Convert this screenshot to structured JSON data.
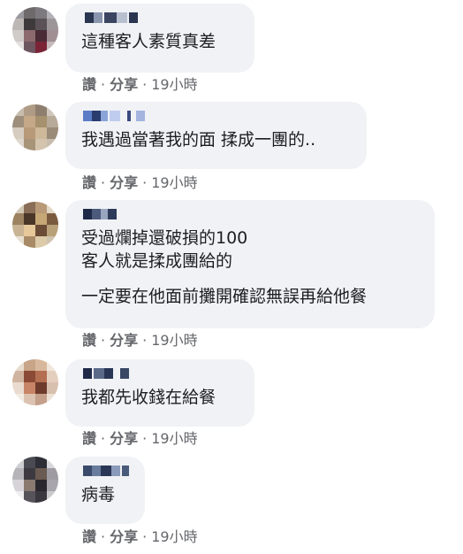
{
  "comments": [
    {
      "lines": [
        "這種客人素質真差"
      ],
      "actions": {
        "like": "讚",
        "share": "分享",
        "separator": "·",
        "time": "19小時"
      }
    },
    {
      "lines": [
        "我遇過當著我的面 揉成一團的.."
      ],
      "actions": {
        "like": "讚",
        "share": "分享",
        "separator": "·",
        "time": "19小時"
      }
    },
    {
      "lines": [
        "受過爛掉還破損的100",
        "客人就是揉成團給的",
        "一定要在他面前攤開確認無誤再給他餐"
      ],
      "actions": {
        "like": "讚",
        "share": "分享",
        "separator": "·",
        "time": "19小時"
      }
    },
    {
      "lines": [
        "我都先收錢在給餐"
      ],
      "actions": {
        "like": "讚",
        "share": "分享",
        "separator": "·",
        "time": "19小時"
      }
    },
    {
      "lines": [
        "病毒"
      ],
      "actions": {
        "like": "讚",
        "share": "分享",
        "separator": "·",
        "time": "19小時"
      }
    }
  ],
  "colors": {
    "bubble": "#f0f2f5",
    "meta_text": "#65676b",
    "body_text": "#1c1e21"
  },
  "icons": {
    "avatar": "pixelated-avatar-icon",
    "name": "pixelated-name-redaction"
  }
}
